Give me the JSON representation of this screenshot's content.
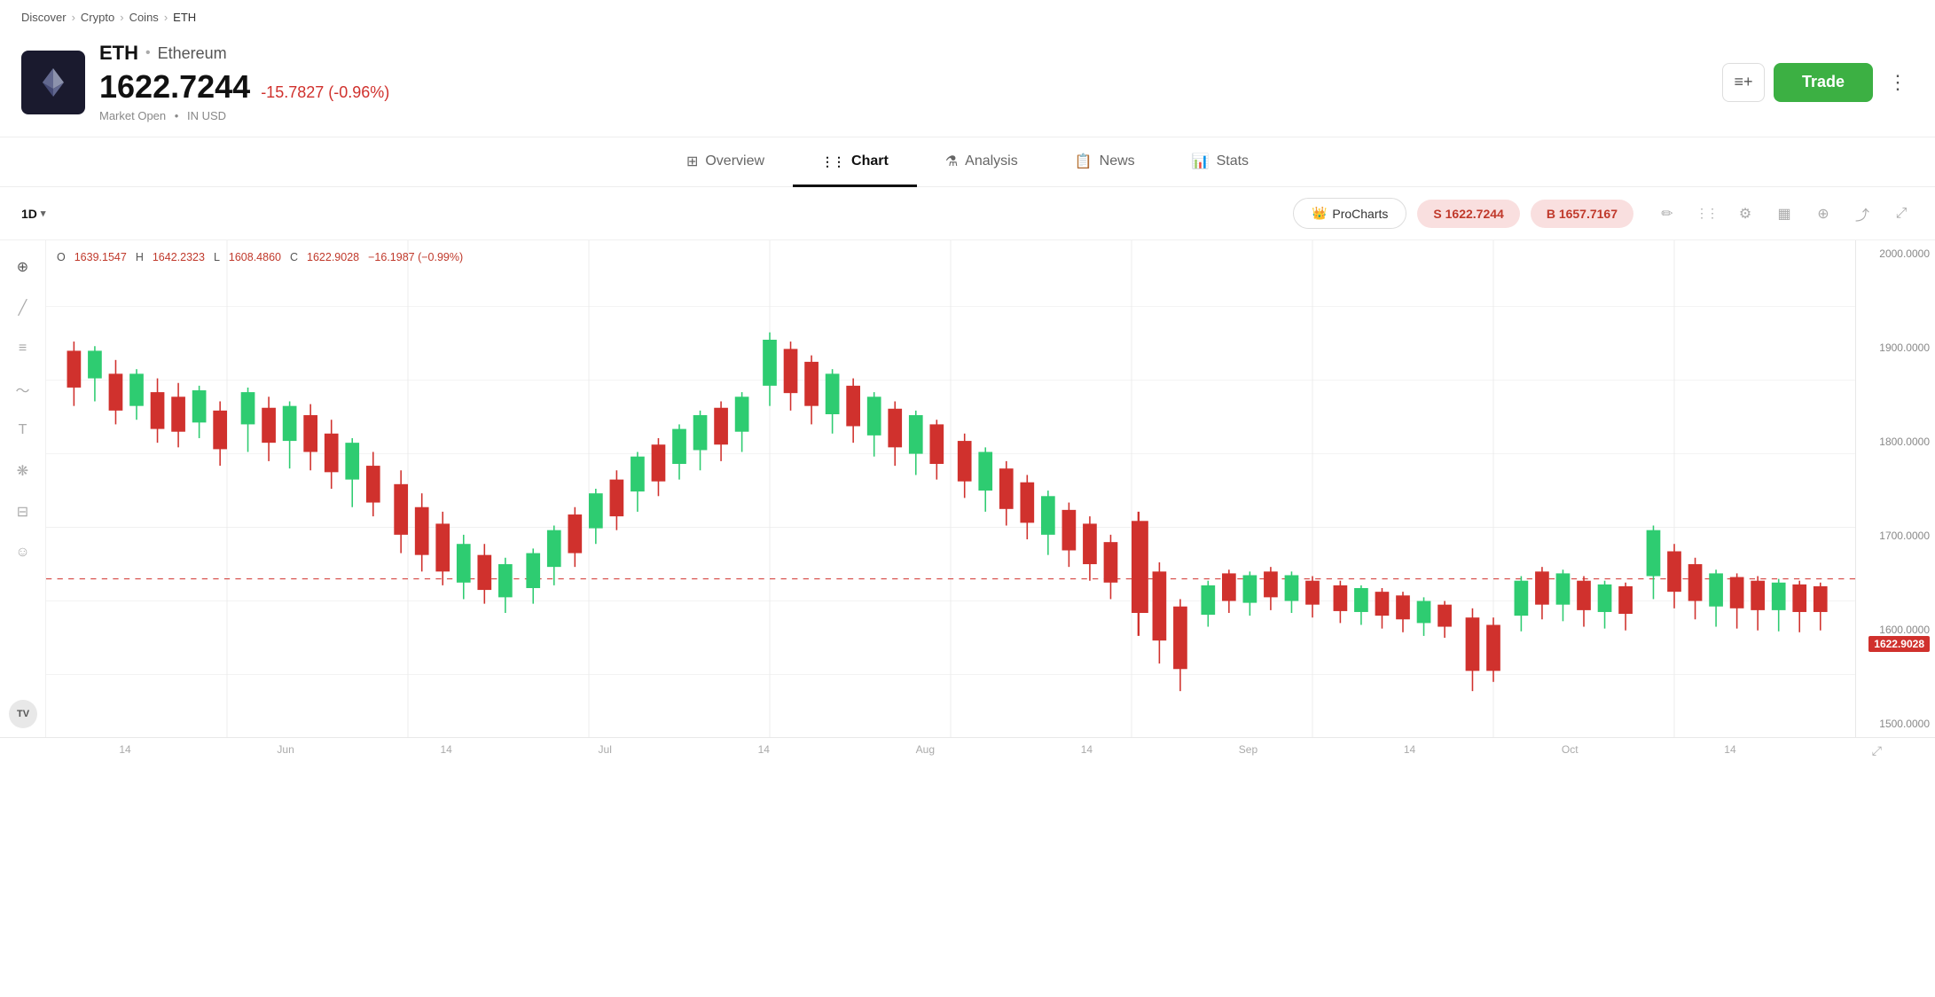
{
  "breadcrumb": {
    "items": [
      "Discover",
      "Crypto",
      "Coins",
      "ETH"
    ],
    "separators": [
      ">",
      ">",
      ">"
    ]
  },
  "header": {
    "ticker": "ETH",
    "separator": "•",
    "full_name": "Ethereum",
    "price": "1622.7244",
    "price_change": "-15.7827 (-0.96%)",
    "market_status": "Market Open",
    "currency": "IN USD",
    "watchlist_label": "≡+",
    "trade_label": "Trade",
    "more_label": "⋮"
  },
  "tabs": [
    {
      "id": "overview",
      "label": "Overview",
      "icon": "⊞",
      "active": false
    },
    {
      "id": "chart",
      "label": "Chart",
      "icon": "⋮⋮",
      "active": true
    },
    {
      "id": "analysis",
      "label": "Analysis",
      "icon": "⚗",
      "active": false
    },
    {
      "id": "news",
      "label": "News",
      "icon": "📋",
      "active": false
    },
    {
      "id": "stats",
      "label": "Stats",
      "icon": "📊",
      "active": false
    }
  ],
  "chart_toolbar": {
    "timeframe": "1D",
    "procharts_label": "ProCharts",
    "sell_label": "S 1622.7244",
    "buy_label": "B 1657.7167"
  },
  "ohlc": {
    "o_label": "O",
    "o_val": "1639.1547",
    "h_label": "H",
    "h_val": "1642.2323",
    "l_label": "L",
    "l_val": "1608.4860",
    "c_label": "C",
    "c_val": "1622.9028",
    "change": "−16.1987 (−0.99%)"
  },
  "price_scale": {
    "levels": [
      "2000.0000",
      "1900.0000",
      "1800.0000",
      "1700.0000",
      "1600.0000",
      "1500.0000"
    ],
    "current": "1622.9028"
  },
  "date_axis": {
    "labels": [
      "14",
      "Jun",
      "14",
      "Jul",
      "14",
      "Aug",
      "14",
      "Sep",
      "14",
      "Oct",
      "14"
    ]
  },
  "left_tools": [
    {
      "name": "crosshair",
      "symbol": "⊕"
    },
    {
      "name": "line",
      "symbol": "╱"
    },
    {
      "name": "horizontal-line",
      "symbol": "≡"
    },
    {
      "name": "curve",
      "symbol": "∿"
    },
    {
      "name": "text",
      "symbol": "T"
    },
    {
      "name": "nodes",
      "symbol": "❋"
    },
    {
      "name": "sliders",
      "symbol": "⊟"
    },
    {
      "name": "emoji",
      "symbol": "☺"
    }
  ],
  "toolbar_icons": [
    {
      "name": "pencil-icon",
      "symbol": "✏"
    },
    {
      "name": "candles-icon",
      "symbol": "⋮⋮"
    },
    {
      "name": "settings-icon",
      "symbol": "⚙"
    },
    {
      "name": "bar-chart-icon",
      "symbol": "▦"
    },
    {
      "name": "plus-circle-icon",
      "symbol": "⊕"
    },
    {
      "name": "share-icon",
      "symbol": "⤴"
    },
    {
      "name": "expand-icon",
      "symbol": "⤢"
    }
  ]
}
